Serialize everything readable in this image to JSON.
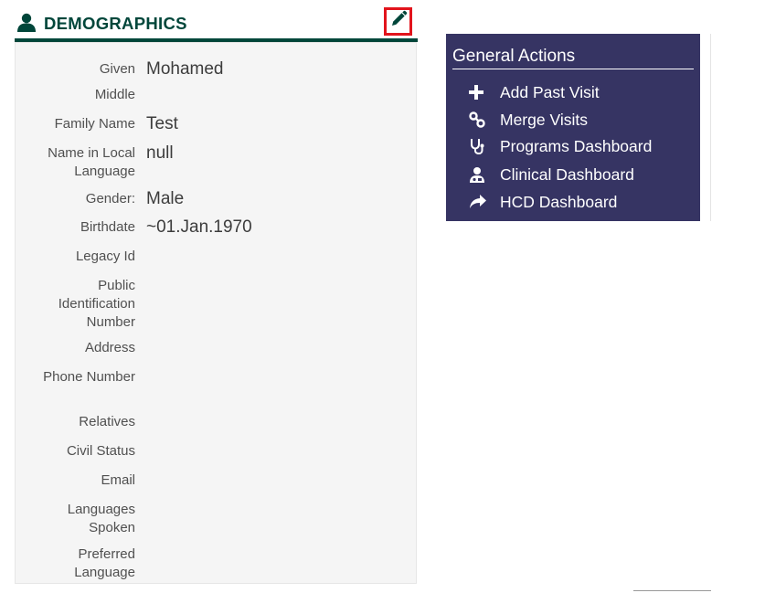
{
  "demographics": {
    "title": "DEMOGRAPHICS",
    "fields": [
      {
        "label": "Given",
        "value": "Mohamed"
      },
      {
        "label": "Middle",
        "value": ""
      },
      {
        "label": "Family Name",
        "value": "Test"
      },
      {
        "label": "Name in Local Language",
        "value": "null"
      },
      {
        "label": "Gender:",
        "value": "Male"
      },
      {
        "label": "Birthdate",
        "value": "~01.Jan.1970"
      },
      {
        "label": "Legacy Id",
        "value": ""
      },
      {
        "label": "Public Identification Number",
        "value": ""
      },
      {
        "label": "Address",
        "value": ""
      },
      {
        "label": "Phone Number",
        "value": ""
      },
      {
        "label": "Relatives",
        "value": ""
      },
      {
        "label": "Civil Status",
        "value": ""
      },
      {
        "label": "Email",
        "value": ""
      },
      {
        "label": "Languages Spoken",
        "value": ""
      },
      {
        "label": "Preferred Language",
        "value": ""
      }
    ]
  },
  "general_actions": {
    "title": "General Actions",
    "items": [
      {
        "label": "Add Past Visit",
        "icon": "plus-icon"
      },
      {
        "label": "Merge Visits",
        "icon": "link-icon"
      },
      {
        "label": "Programs Dashboard",
        "icon": "stethoscope-icon"
      },
      {
        "label": "Clinical Dashboard",
        "icon": "user-md-icon"
      },
      {
        "label": "HCD Dashboard",
        "icon": "share-icon"
      }
    ]
  },
  "colors": {
    "header_green": "#00463a",
    "actions_bg": "#363463",
    "edit_highlight": "#e2141c"
  }
}
